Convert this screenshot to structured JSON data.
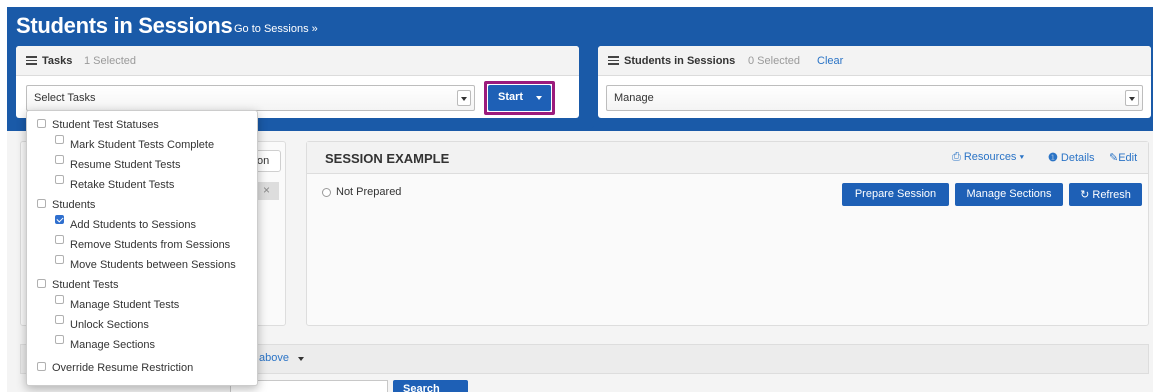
{
  "header": {
    "title": "Students in Sessions",
    "go_link": "Go to Sessions »",
    "band_color": "#1a5aa8"
  },
  "tasks_panel": {
    "title": "Tasks",
    "count": "1 Selected",
    "select_value": "Select Tasks",
    "start_button": "Start",
    "icon": "list-icon"
  },
  "sessions_panel": {
    "title": "Students in Sessions",
    "count": "0 Selected",
    "clear_link": "Clear",
    "select_value": "Manage",
    "icon": "table-icon"
  },
  "tasks_dropdown": {
    "items": [
      {
        "label": "Student Test Statuses",
        "level": 0,
        "checked": false
      },
      {
        "label": "Mark Student Tests Complete",
        "level": 1,
        "checked": false
      },
      {
        "label": "Resume Student Tests",
        "level": 1,
        "checked": false
      },
      {
        "label": "Retake Student Tests",
        "level": 1,
        "checked": false
      },
      {
        "label": "Students",
        "level": 0,
        "checked": false
      },
      {
        "label": "Add Students to Sessions",
        "level": 1,
        "checked": true
      },
      {
        "label": "Remove Students from Sessions",
        "level": 1,
        "checked": false
      },
      {
        "label": "Move Students between Sessions",
        "level": 1,
        "checked": false
      },
      {
        "label": "Student Tests",
        "level": 0,
        "checked": false
      },
      {
        "label": "Manage Student Tests",
        "level": 1,
        "checked": false
      },
      {
        "label": "Unlock Sections",
        "level": 1,
        "checked": false
      },
      {
        "label": "Manage Sections",
        "level": 1,
        "checked": false
      },
      {
        "label": "Override Resume Restriction",
        "level": 0,
        "checked": false
      }
    ]
  },
  "left_card": {
    "partial_button": "on",
    "partial_tag_close": "×"
  },
  "session": {
    "title": "SESSION EXAMPLE",
    "resources_link": "Resources",
    "details_link": "Details",
    "edit_link": "Edit",
    "status": "Not Prepared",
    "buttons": {
      "prepare": "Prepare Session",
      "manage": "Manage Sections",
      "refresh": "Refresh"
    }
  },
  "bottom": {
    "above_link": "above",
    "search_button": "Search"
  },
  "colors": {
    "accent": "#1e60b6",
    "highlight": "#9b1b7c",
    "link": "#2b74c6"
  }
}
